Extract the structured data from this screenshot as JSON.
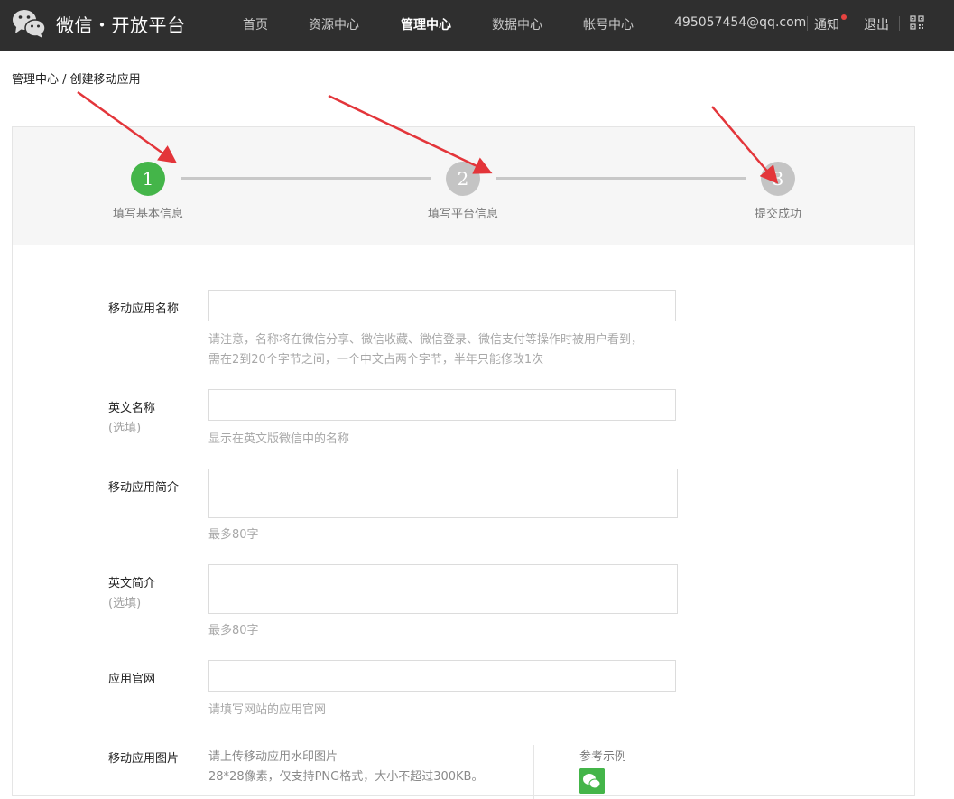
{
  "header": {
    "brand": "微信・开放平台",
    "nav": [
      {
        "label": "首页",
        "active": false
      },
      {
        "label": "资源中心",
        "active": false
      },
      {
        "label": "管理中心",
        "active": true
      },
      {
        "label": "数据中心",
        "active": false
      },
      {
        "label": "帐号中心",
        "active": false
      }
    ],
    "account": "495057454@qq.com",
    "notice_label": "通知",
    "logout_label": "退出",
    "icons": {
      "logo": "wechat-logo-icon",
      "qr": "qr-code-icon"
    }
  },
  "breadcrumb": "管理中心 / 创建移动应用",
  "steps": [
    {
      "number": "1",
      "label": "填写基本信息",
      "active": true
    },
    {
      "number": "2",
      "label": "填写平台信息",
      "active": false
    },
    {
      "number": "3",
      "label": "提交成功",
      "active": false
    }
  ],
  "colors": {
    "active_step": "#44b549",
    "inactive_step": "#c4c4c4",
    "annotation_arrow": "#e3353a",
    "topbar": "#2f2f2f"
  },
  "form": {
    "app_name": {
      "label": "移动应用名称",
      "value": "",
      "hint_line1": "请注意，名称将在微信分享、微信收藏、微信登录、微信支付等操作时被用户看到，",
      "hint_line2": "需在2到20个字节之间，一个中文占两个字节，半年只能修改1次"
    },
    "english_name": {
      "label": "英文名称",
      "optional": "(选填)",
      "value": "",
      "hint": "显示在英文版微信中的名称"
    },
    "app_intro": {
      "label": "移动应用简介",
      "value": "",
      "hint": "最多80字"
    },
    "english_intro": {
      "label": "英文简介",
      "optional": "(选填)",
      "value": "",
      "hint": "最多80字"
    },
    "website": {
      "label": "应用官网",
      "value": "",
      "hint": "请填写网站的应用官网"
    },
    "app_image": {
      "label": "移动应用图片",
      "hint_line1": "请上传移动应用水印图片",
      "hint_line2": "28*28像素，仅支持PNG格式，大小不超过300KB。",
      "reference_label": "参考示例"
    }
  }
}
